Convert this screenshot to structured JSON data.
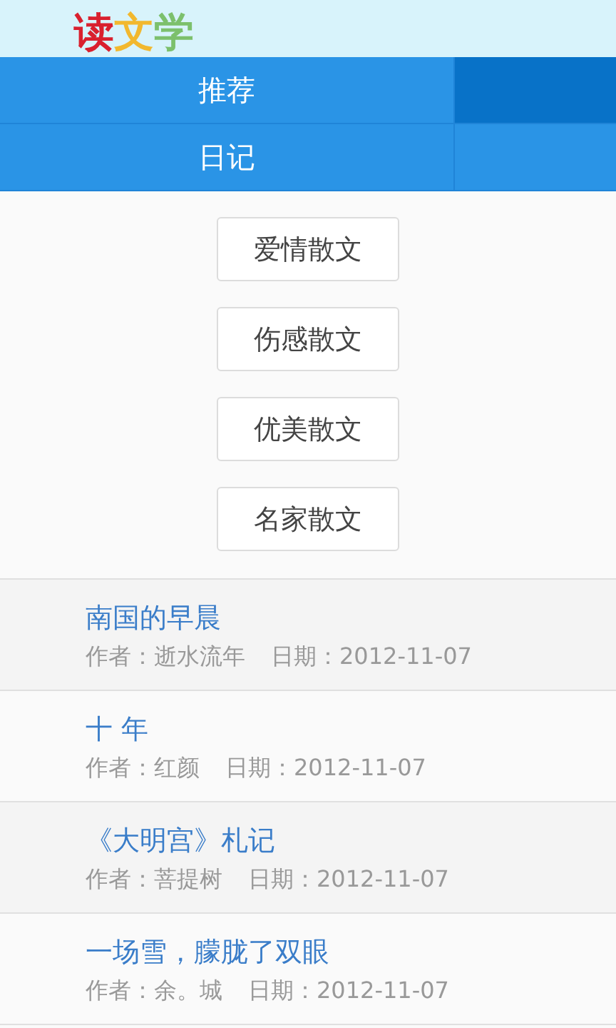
{
  "logo": [
    {
      "text": "读",
      "color": "#d9202e"
    },
    {
      "text": "文",
      "color": "#f2b82e"
    },
    {
      "text": "学",
      "color": "#7cc06c"
    }
  ],
  "nav": [
    {
      "label": "推荐",
      "selected": true
    },
    {
      "label": "日记",
      "selected": false
    }
  ],
  "categories": [
    "爱情散文",
    "伤感散文",
    "优美散文",
    "名家散文"
  ],
  "articles": [
    {
      "title": "南国的早晨",
      "author": "作者：逝水流年",
      "date": "日期：2012-11-07"
    },
    {
      "title": "十 年",
      "author": "作者：红颜",
      "date": "日期：2012-11-07"
    },
    {
      "title": "《大明宫》札记",
      "author": "作者：菩提树",
      "date": "日期：2012-11-07"
    },
    {
      "title": "一场雪，朦胧了双眼",
      "author": "作者：余。城",
      "date": "日期：2012-11-07"
    }
  ]
}
